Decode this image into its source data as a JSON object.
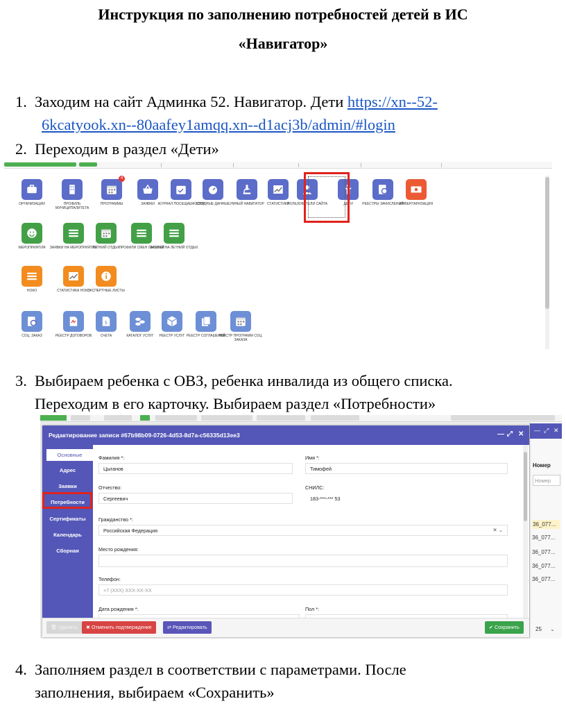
{
  "document": {
    "title_line1": "Инструкция по заполнению потребностей детей в ИС",
    "title_line2": "«Навигатор»",
    "steps": [
      {
        "num": "1.",
        "text": "Заходим на сайт Админка 52. Навигатор. Дети ",
        "link_line1": "https://xn--52-",
        "link_line2": "6kcatyook.xn--80aafey1amqq.xn--d1acj3b/admin/#login"
      },
      {
        "num": "2.",
        "text": "Переходим в раздел «Дети»"
      },
      {
        "num": "3.",
        "text_line1": "Выбираем ребенка с ОВЗ, ребенка инвалида из общего списка.",
        "text_line2": "Переходим в его карточку. Выбираем раздел «Потребности»"
      },
      {
        "num": "4.",
        "text_line1": "Заполняем раздел в соответствии с параметрами. После",
        "text_line2": "заполнения, выбираем «Сохранить»"
      }
    ]
  },
  "admin_menu": {
    "tiles": [
      {
        "label": "Организации",
        "color": "#5b6cc9",
        "icon": "briefcase-icon"
      },
      {
        "label": "Профиль муниципалитета",
        "color": "#5b6cc9",
        "icon": "building-icon"
      },
      {
        "label": "Программы",
        "color": "#5b6cc9",
        "icon": "calendar-icon",
        "badge": "4"
      },
      {
        "label": "Заявки",
        "color": "#5b6cc9",
        "icon": "basket-icon"
      },
      {
        "label": "Журнал посещаемости",
        "color": "#5b6cc9",
        "icon": "calendar-check-icon"
      },
      {
        "label": "Сводные данные",
        "color": "#5b6cc9",
        "icon": "gauge-icon"
      },
      {
        "label": "Умный навигатор",
        "color": "#5b6cc9",
        "icon": "microscope-icon"
      },
      {
        "label": "Статистика",
        "color": "#5b6cc9",
        "icon": "chart-icon"
      },
      {
        "label": "Пользователи сайта",
        "color": "#5b6cc9",
        "icon": "user-icon"
      },
      {
        "label": "Дети",
        "color": "#5b6cc9",
        "icon": "child-icon"
      },
      {
        "label": "Реестры зачислений",
        "color": "#5b6cc9",
        "icon": "map-pin-icon"
      },
      {
        "label": "Инвентаризация",
        "color": "#ec5a34",
        "icon": "money-icon"
      },
      {
        "label": "Мероприятия",
        "color": "#43a047",
        "icon": "smile-icon"
      },
      {
        "label": "Заявки на мероприятия",
        "color": "#43a047",
        "icon": "list-icon"
      },
      {
        "label": "Летний отдых",
        "color": "#43a047",
        "icon": "calendar-icon"
      },
      {
        "label": "Профили смен лагерей",
        "color": "#43a047",
        "icon": "list-icon"
      },
      {
        "label": "Заявки на летний отдых",
        "color": "#43a047",
        "icon": "list-icon"
      },
      {
        "label": "НОКО",
        "color": "#f28c1f",
        "icon": "list-icon"
      },
      {
        "label": "Статистика НОКО",
        "color": "#f28c1f",
        "icon": "chart-icon"
      },
      {
        "label": "Экспертные листы",
        "color": "#f28c1f",
        "icon": "info-icon"
      },
      {
        "label": "Соц. заказ",
        "color": "#6d8fd6",
        "icon": "map-pin-icon"
      },
      {
        "label": "Реестр договоров",
        "color": "#6d8fd6",
        "icon": "pdf-icon"
      },
      {
        "label": "Счета",
        "color": "#6d8fd6",
        "icon": "invoice-icon"
      },
      {
        "label": "Каталог услуг",
        "color": "#6d8fd6",
        "icon": "coins-icon"
      },
      {
        "label": "Реестр услуг",
        "color": "#6d8fd6",
        "icon": "box-icon"
      },
      {
        "label": "Реестр соглашений",
        "color": "#6d8fd6",
        "icon": "copy-icon"
      },
      {
        "label": "Реестр программ соц. заказа",
        "color": "#6d8fd6",
        "icon": "calendar-icon"
      }
    ]
  },
  "edit_dialog": {
    "title": "Редактирование записи #67b98b09-0726-4d53-8d7a-c56335d13ee3",
    "controls": [
      "—",
      "⤢",
      "✕"
    ],
    "tabs": [
      "Основные",
      "Адрес",
      "Заявки",
      "Потребности",
      "Сертификаты",
      "Календарь",
      "Сборная"
    ],
    "fields": {
      "lastname_label": "Фамилия *:",
      "lastname_value": "Цыганов",
      "firstname_label": "Имя *:",
      "firstname_value": "Тимофей",
      "patronymic_label": "Отчество:",
      "patronymic_value": "Сергеевич",
      "snils_label": "СНИЛС:",
      "snils_value": "183-***-*** 53",
      "citizenship_label": "Гражданство *:",
      "citizenship_value": "Российская Федерация",
      "birthplace_label": "Место рождения:",
      "birthplace_value": "",
      "phone_label": "Телефон:",
      "phone_placeholder": "+7 (XXX) XXX-XX-XX",
      "birthdate_label": "Дата рождения *:",
      "gender_label": "Пол *:"
    },
    "buttons": {
      "delete": "Удалить",
      "cancel_confirm": "Отменить подтверждение",
      "edit": "Редактировать",
      "save": "Сохранить"
    }
  },
  "list_panel": {
    "column": "Номер",
    "filter_placeholder": "Номер",
    "rows": [
      "36_077...",
      "36_077...",
      "36_077...",
      "36_077...",
      "36_077..."
    ],
    "page_size": "25"
  }
}
